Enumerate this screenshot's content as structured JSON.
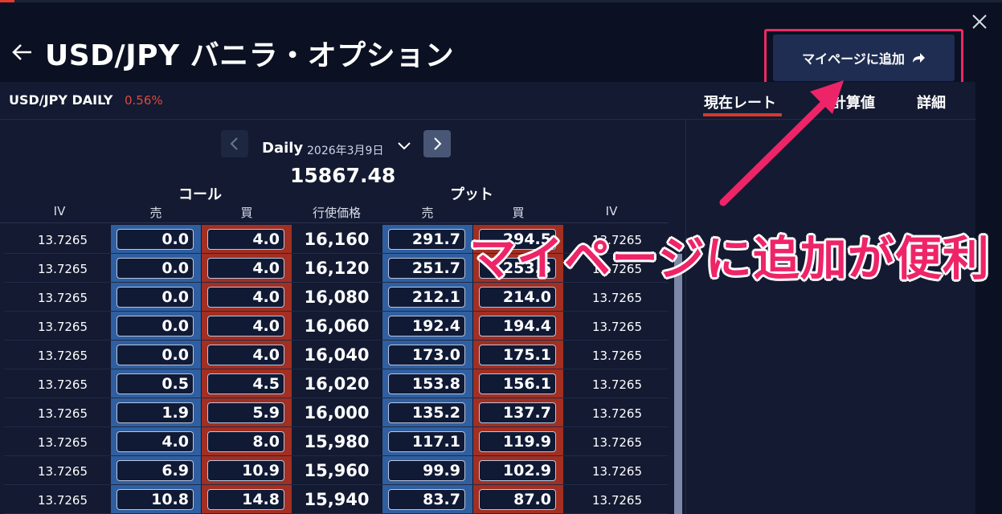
{
  "header": {
    "title": "USD/JPY バニラ・オプション",
    "add_button_label": "マイページに追加"
  },
  "summary": {
    "pair": "USD/JPY DAILY",
    "change": "0.56%"
  },
  "tabs": [
    {
      "label": "現在レート",
      "active": true
    },
    {
      "label": "計算値",
      "active": false
    },
    {
      "label": "詳細",
      "active": false
    }
  ],
  "selector": {
    "period": "Daily",
    "date": "2026年3月9日"
  },
  "underlying_price": "15867.48",
  "groups": {
    "call": "コール",
    "put": "プット"
  },
  "columns": {
    "iv_left": "IV",
    "call_bid": "売",
    "call_ask": "買",
    "strike": "行使価格",
    "put_bid": "売",
    "put_ask": "買",
    "iv_right": "IV"
  },
  "rows": [
    {
      "iv_call": "13.7265",
      "call_bid": "0.0",
      "call_ask": "4.0",
      "strike": "16,160",
      "put_bid": "291.7",
      "put_ask": "294.5",
      "iv_put": "13.7265"
    },
    {
      "iv_call": "13.7265",
      "call_bid": "0.0",
      "call_ask": "4.0",
      "strike": "16,120",
      "put_bid": "251.7",
      "put_ask": "253.6",
      "iv_put": "13.7265"
    },
    {
      "iv_call": "13.7265",
      "call_bid": "0.0",
      "call_ask": "4.0",
      "strike": "16,080",
      "put_bid": "212.1",
      "put_ask": "214.0",
      "iv_put": "13.7265"
    },
    {
      "iv_call": "13.7265",
      "call_bid": "0.0",
      "call_ask": "4.0",
      "strike": "16,060",
      "put_bid": "192.4",
      "put_ask": "194.4",
      "iv_put": "13.7265"
    },
    {
      "iv_call": "13.7265",
      "call_bid": "0.0",
      "call_ask": "4.0",
      "strike": "16,040",
      "put_bid": "173.0",
      "put_ask": "175.1",
      "iv_put": "13.7265"
    },
    {
      "iv_call": "13.7265",
      "call_bid": "0.5",
      "call_ask": "4.5",
      "strike": "16,020",
      "put_bid": "153.8",
      "put_ask": "156.1",
      "iv_put": "13.7265"
    },
    {
      "iv_call": "13.7265",
      "call_bid": "1.9",
      "call_ask": "5.9",
      "strike": "16,000",
      "put_bid": "135.2",
      "put_ask": "137.7",
      "iv_put": "13.7265"
    },
    {
      "iv_call": "13.7265",
      "call_bid": "4.0",
      "call_ask": "8.0",
      "strike": "15,980",
      "put_bid": "117.1",
      "put_ask": "119.9",
      "iv_put": "13.7265"
    },
    {
      "iv_call": "13.7265",
      "call_bid": "6.9",
      "call_ask": "10.9",
      "strike": "15,960",
      "put_bid": "99.9",
      "put_ask": "102.9",
      "iv_put": "13.7265"
    },
    {
      "iv_call": "13.7265",
      "call_bid": "10.8",
      "call_ask": "14.8",
      "strike": "15,940",
      "put_bid": "83.7",
      "put_ask": "87.0",
      "iv_put": "13.7265"
    }
  ],
  "annotation": {
    "text": "マイページに追加が便利"
  },
  "colors": {
    "background": "#0b1122",
    "panel": "#131a31",
    "bid_cell": "#2f5fa0",
    "ask_cell": "#a22f22",
    "change_negative": "#e0493c",
    "tab_underline": "#d43a2c",
    "annotation": "#ee2468"
  },
  "icons": {
    "back": "arrow-left-icon",
    "close": "close-icon",
    "share": "share-arrow-icon",
    "prev": "chevron-left-icon",
    "next": "chevron-right-icon",
    "dropdown": "chevron-down-icon"
  }
}
